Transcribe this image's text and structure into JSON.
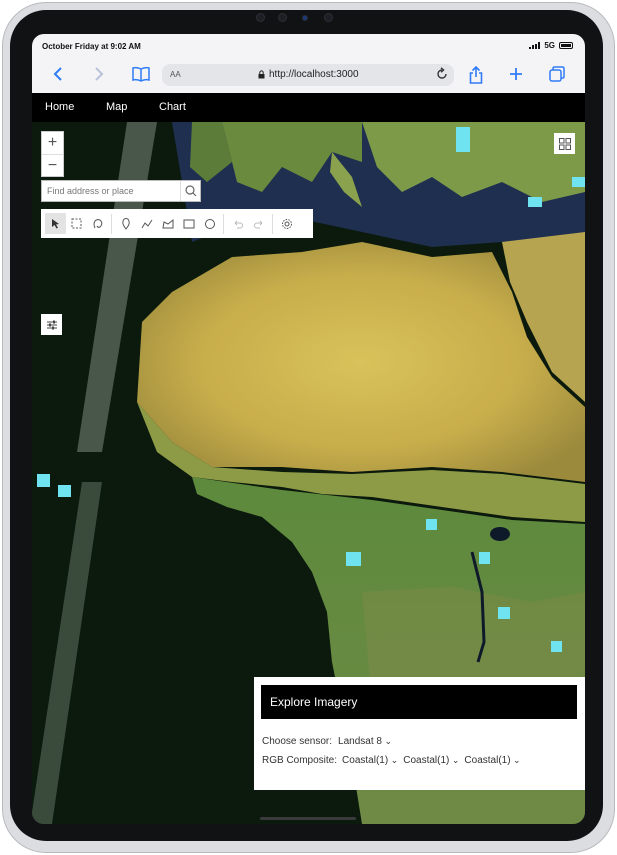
{
  "status_bar": {
    "time": "October Friday at 9:02 AM",
    "network": "5G"
  },
  "browser": {
    "back_icon": "chevron-left-icon",
    "forward_icon": "chevron-right-icon",
    "text_size_label": "AA",
    "url": "http://localhost:3000"
  },
  "app_nav": {
    "items": [
      "Home",
      "Map",
      "Chart"
    ]
  },
  "map": {
    "zoom_in": "+",
    "zoom_out": "−",
    "search_placeholder": "Find address or place"
  },
  "panel": {
    "title": "Explore Imagery",
    "sensor_label": "Choose sensor:",
    "sensor_value": "Landsat 8",
    "rgb_label": "RGB Composite:",
    "rgb_values": [
      "Coastal(1)",
      "Coastal(1)",
      "Coastal(1)"
    ]
  },
  "colors": {
    "accent": "#2f7cf6",
    "nav_bg": "#000000",
    "ocean": "#0b1a0d"
  }
}
